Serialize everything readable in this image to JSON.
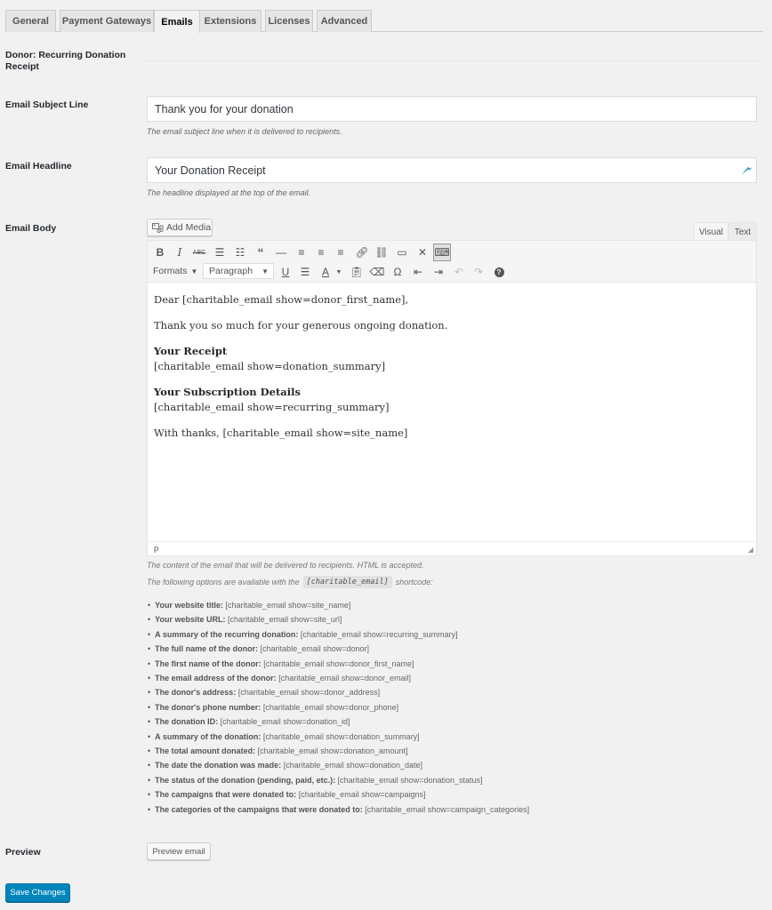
{
  "tabs": [
    {
      "label": "General",
      "active": false
    },
    {
      "label": "Payment Gateways",
      "active": false
    },
    {
      "label": "Emails",
      "active": true
    },
    {
      "label": "Extensions",
      "active": false
    },
    {
      "label": "Licenses",
      "active": false
    },
    {
      "label": "Advanced",
      "active": false
    }
  ],
  "section_title": "Donor: Recurring Donation Receipt",
  "subject": {
    "label": "Email Subject Line",
    "value": "Thank you for your donation",
    "description": "The email subject line when it is delivered to recipients."
  },
  "headline": {
    "label": "Email Headline",
    "value": "Your Donation Receipt",
    "description": "The headline displayed at the top of the email."
  },
  "body": {
    "label": "Email Body",
    "add_media_label": "Add Media",
    "editor_tabs": {
      "visual": "Visual",
      "text": "Text"
    },
    "toolbar": {
      "formats_label": "Formats",
      "paragraph_value": "Paragraph",
      "row1": [
        "bold",
        "italic",
        "strikethrough",
        "bullet-list",
        "numbered-list",
        "blockquote",
        "horizontal-line",
        "align-left",
        "align-center",
        "align-right",
        "insert-link",
        "remove-link",
        "read-more",
        "fullscreen",
        "toolbar-toggle"
      ],
      "row2": [
        "underline",
        "justify",
        "text-color",
        "paste-as-text",
        "clear-formatting",
        "special-character",
        "outdent",
        "indent",
        "undo",
        "redo",
        "help"
      ]
    },
    "content": {
      "greeting": "Dear [charitable_email show=donor_first_name],",
      "thanks": "Thank you so much for your generous ongoing donation.",
      "receipt_heading": "Your Receipt",
      "receipt_shortcode": "[charitable_email show=donation_summary]",
      "subscription_heading": "Your Subscription Details",
      "subscription_shortcode": "[charitable_email show=recurring_summary]",
      "signoff": "With thanks, [charitable_email show=site_name]"
    },
    "status_path": "p",
    "help_text": "The content of the email that will be delivered to recipients. HTML is accepted.",
    "options_intro_before": "The following options are available with the",
    "options_intro_code": "[charitable_email]",
    "options_intro_after": "shortcode:",
    "options": [
      {
        "label": "Your website title:",
        "code": "[charitable_email show=site_name]"
      },
      {
        "label": "Your website URL:",
        "code": "[charitable_email show=site_url]"
      },
      {
        "label": "A summary of the recurring donation:",
        "code": "[charitable_email show=recurring_summary]"
      },
      {
        "label": "The full name of the donor:",
        "code": "[charitable_email show=donor]"
      },
      {
        "label": "The first name of the donor:",
        "code": "[charitable_email show=donor_first_name]"
      },
      {
        "label": "The email address of the donor:",
        "code": "[charitable_email show=donor_email]"
      },
      {
        "label": "The donor's address:",
        "code": "[charitable_email show=donor_address]"
      },
      {
        "label": "The donor's phone number:",
        "code": "[charitable_email show=donor_phone]"
      },
      {
        "label": "The donation ID:",
        "code": "[charitable_email show=donation_id]"
      },
      {
        "label": "A summary of the donation:",
        "code": "[charitable_email show=donation_summary]"
      },
      {
        "label": "The total amount donated:",
        "code": "[charitable_email show=donation_amount]"
      },
      {
        "label": "The date the donation was made:",
        "code": "[charitable_email show=donation_date]"
      },
      {
        "label": "The status of the donation (pending, paid, etc.):",
        "code": "[charitable_email show=donation_status]"
      },
      {
        "label": "The campaigns that were donated to:",
        "code": "[charitable_email show=campaigns]"
      },
      {
        "label": "The categories of the campaigns that were donated to:",
        "code": "[charitable_email show=campaign_categories]"
      }
    ]
  },
  "preview": {
    "label": "Preview",
    "button_label": "Preview email"
  },
  "save_label": "Save Changes",
  "colors": {
    "primary": "#0085ba",
    "background": "#f1f1f1"
  }
}
